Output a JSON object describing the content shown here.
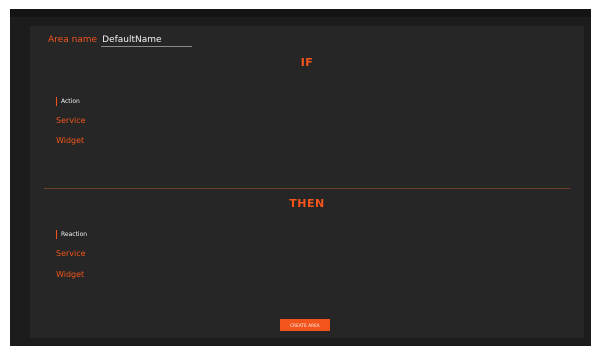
{
  "area": {
    "label": "Area name",
    "value": "DefaultName"
  },
  "if_section": {
    "title": "IF",
    "label": "Action",
    "items": [
      {
        "label": "Service"
      },
      {
        "label": "Widget"
      }
    ]
  },
  "then_section": {
    "title": "THEN",
    "label": "Reaction",
    "items": [
      {
        "label": "Service"
      },
      {
        "label": "Widget"
      }
    ]
  },
  "create_button": {
    "label": "CREATE AREA"
  },
  "colors": {
    "accent": "#f2541b",
    "panel": "#262626",
    "background": "#1c1c1c",
    "text": "#f3f3f3"
  }
}
